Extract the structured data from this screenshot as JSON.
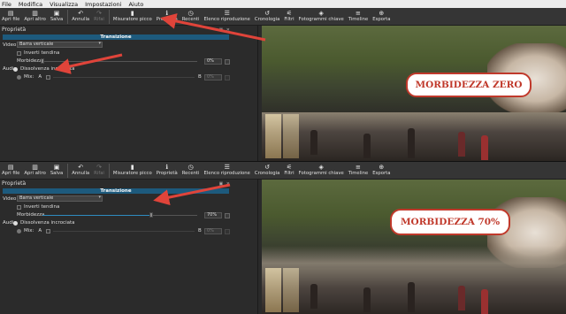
{
  "menu": [
    "File",
    "Modifica",
    "Visualizza",
    "Impostazioni",
    "Aiuto"
  ],
  "toolbar": {
    "items": [
      {
        "label": "Apri file",
        "icon": "folder-icon",
        "glyph": "▤"
      },
      {
        "label": "Apri altro",
        "icon": "open-other-icon",
        "glyph": "▥"
      },
      {
        "label": "Salva",
        "icon": "save-icon",
        "glyph": "▣"
      },
      {
        "label": "Annulla",
        "icon": "undo-icon",
        "glyph": "↶"
      },
      {
        "label": "Rifai",
        "icon": "redo-icon",
        "glyph": "↷"
      },
      {
        "label": "Misuratore picco",
        "icon": "peak-meter-icon",
        "glyph": "▮"
      },
      {
        "label": "Proprietà",
        "icon": "info-icon",
        "glyph": "ℹ"
      },
      {
        "label": "Recenti",
        "icon": "clock-icon",
        "glyph": "◷"
      },
      {
        "label": "Elenco riproduzione",
        "icon": "playlist-icon",
        "glyph": "☰"
      },
      {
        "label": "Cronologia",
        "icon": "history-icon",
        "glyph": "↺"
      },
      {
        "label": "Filtri",
        "icon": "filter-icon",
        "glyph": "⚟"
      },
      {
        "label": "Fotogrammi chiave",
        "icon": "keyframes-icon",
        "glyph": "◈"
      },
      {
        "label": "Timeline",
        "icon": "timeline-icon",
        "glyph": "≡"
      },
      {
        "label": "Esporta",
        "icon": "export-icon",
        "glyph": "⊕"
      }
    ]
  },
  "properties": {
    "title": "Proprietà",
    "panel_buttons": "▣ ✕",
    "section_title": "Transizione",
    "video_label": "Video",
    "video_value": "Barra verticale",
    "invert_label": "Inverti tendina",
    "softness_label": "Morbidezza",
    "audio_label": "Audio",
    "crossfade_label": "Dissolvenza incrociata",
    "mix_label": "Mix:",
    "mix_a": "A",
    "mix_b": "B",
    "mix_value": "0%"
  },
  "panes": [
    {
      "softness_value": "0%",
      "softness_level": 0,
      "callout": "MORBIDEZZA ZERO"
    },
    {
      "softness_value": "70%",
      "softness_level": 0.7,
      "callout": "MORBIDEZZA 70%"
    }
  ],
  "colors": {
    "accent": "#1d5a7d",
    "callout_red": "#c0392b",
    "arrow_red": "#e0443a"
  }
}
